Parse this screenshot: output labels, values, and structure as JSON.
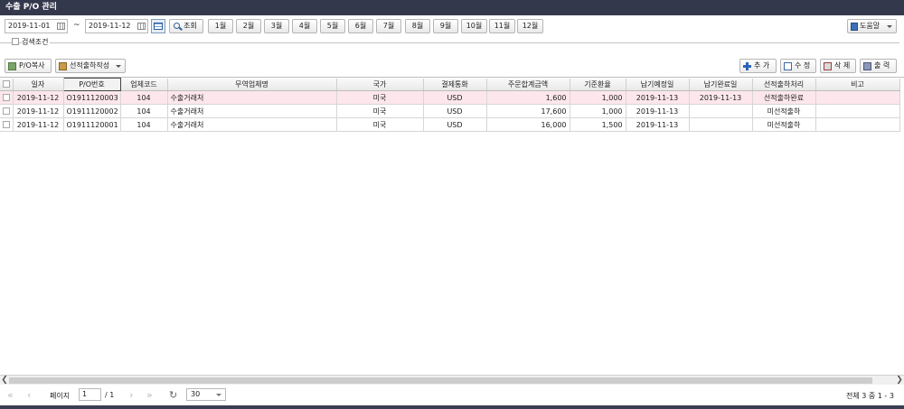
{
  "window": {
    "title": "수출 P/O 관리"
  },
  "filter": {
    "date_from": "2019-11-01",
    "tilde": "~",
    "date_to": "2019-11-12",
    "search_label": "조회",
    "months": [
      "1월",
      "2월",
      "3월",
      "4월",
      "5월",
      "6월",
      "7월",
      "8월",
      "9월",
      "10월",
      "11월",
      "12월"
    ],
    "help_label": "도움말"
  },
  "search_condition": {
    "label": "검색조건"
  },
  "toolbar": {
    "po_copy": "P/O복사",
    "create_shipment": "선적출하작성",
    "add": "추 가",
    "edit": "수 정",
    "delete": "삭 제",
    "print": "출 력"
  },
  "table": {
    "columns": [
      "일자",
      "P/O번호",
      "업체코드",
      "무역업체명",
      "국가",
      "결제통화",
      "주문합계금액",
      "기준환율",
      "납기예정일",
      "납기완료일",
      "선적출하처리",
      "비고"
    ],
    "rows": [
      {
        "date": "2019-11-12",
        "po_no": "O1911120003",
        "vendor_code": "104",
        "vendor_name": "수출거래처",
        "country": "미국",
        "currency": "USD",
        "total": "1,600",
        "rate": "1,000",
        "due_date": "2019-11-13",
        "done_date": "2019-11-13",
        "ship_status": "선적출하완료",
        "remark": ""
      },
      {
        "date": "2019-11-12",
        "po_no": "O1911120002",
        "vendor_code": "104",
        "vendor_name": "수출거래처",
        "country": "미국",
        "currency": "USD",
        "total": "17,600",
        "rate": "1,000",
        "due_date": "2019-11-13",
        "done_date": "",
        "ship_status": "미선적출하",
        "remark": ""
      },
      {
        "date": "2019-11-12",
        "po_no": "O1911120001",
        "vendor_code": "104",
        "vendor_name": "수출거래처",
        "country": "미국",
        "currency": "USD",
        "total": "16,000",
        "rate": "1,500",
        "due_date": "2019-11-13",
        "done_date": "",
        "ship_status": "미선적출하",
        "remark": ""
      }
    ]
  },
  "pager": {
    "page_label": "페이지",
    "page": "1",
    "total_pages": "/ 1",
    "page_size": "30",
    "summary": "전체 3 중 1 - 3"
  },
  "colors": {
    "titlebar": "#34384c",
    "highlight_row": "#fde7ec"
  }
}
